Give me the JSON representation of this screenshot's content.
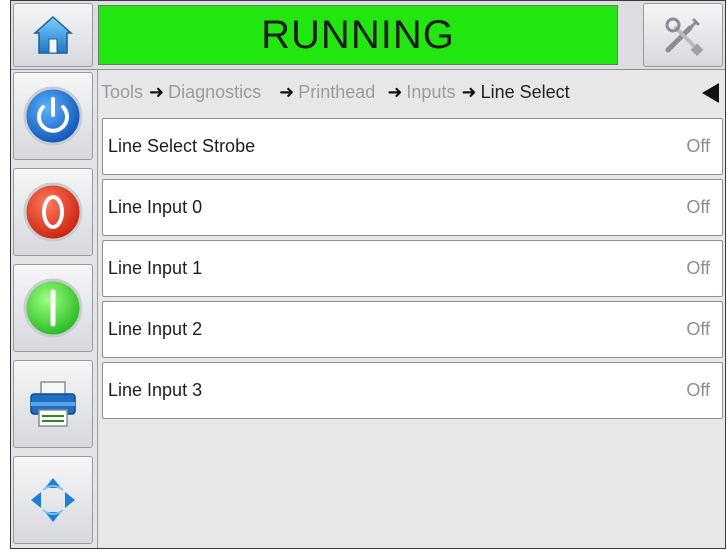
{
  "header": {
    "status": "RUNNING",
    "status_color": "#22e60f",
    "home_icon": "home-icon",
    "tools_icon": "tools-icon"
  },
  "sidebar": {
    "buttons": [
      {
        "name": "power",
        "icon": "power-icon"
      },
      {
        "name": "stop",
        "icon": "stop-icon"
      },
      {
        "name": "start",
        "icon": "start-icon"
      },
      {
        "name": "print",
        "icon": "printer-icon"
      },
      {
        "name": "navigate",
        "icon": "navigation-arrows-icon"
      }
    ]
  },
  "breadcrumb": {
    "items": [
      "Tools",
      "Diagnostics",
      "Printhead",
      "Inputs",
      "Line Select"
    ]
  },
  "rows": [
    {
      "label": "Line Select Strobe",
      "value": "Off"
    },
    {
      "label": "Line Input 0",
      "value": "Off"
    },
    {
      "label": "Line Input 1",
      "value": "Off"
    },
    {
      "label": "Line Input 2",
      "value": "Off"
    },
    {
      "label": "Line Input 3",
      "value": "Off"
    }
  ]
}
